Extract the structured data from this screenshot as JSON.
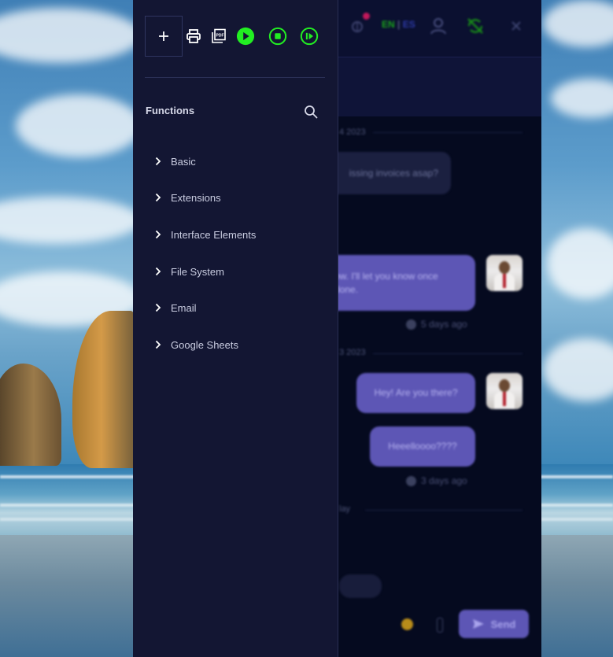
{
  "panel": {
    "title": "Functions",
    "toolbar": {
      "add_icon": "plus-icon",
      "print_icon": "printer-icon",
      "pdf_icon": "pdf-gallery-icon",
      "run_icon": "play-circle-icon",
      "stop_icon": "stop-circle-icon",
      "step_icon": "step-forward-circle-icon"
    },
    "search_icon": "magnifier-icon",
    "items": [
      {
        "label": "Basic"
      },
      {
        "label": "Extensions"
      },
      {
        "label": "Interface Elements"
      },
      {
        "label": "File System"
      },
      {
        "label": "Email"
      },
      {
        "label": "Google Sheets"
      }
    ]
  },
  "chat": {
    "header": {
      "lang_en": "EN",
      "lang_sep": "|",
      "lang_es": "ES"
    },
    "date_1": "4 2023",
    "date_2": "3 2023",
    "date_3": "lay",
    "messages": [
      {
        "text": "issing invoices asap?",
        "direction": "in"
      },
      {
        "text": "ow. I'll let you know once\ndone.",
        "direction": "out"
      },
      {
        "text": "5 days ago",
        "kind": "time"
      },
      {
        "text": "Hey! Are you there?",
        "direction": "out"
      },
      {
        "text": "Heeelloooo????",
        "direction": "out"
      },
      {
        "text": "3 days ago",
        "kind": "time"
      }
    ],
    "send_label": "Send"
  },
  "colors": {
    "panel_bg": "#131633",
    "chat_bg": "#050a1f",
    "accent_green": "#22ee22",
    "bubble_out": "#5d56b5",
    "bubble_in": "#1b2040"
  }
}
